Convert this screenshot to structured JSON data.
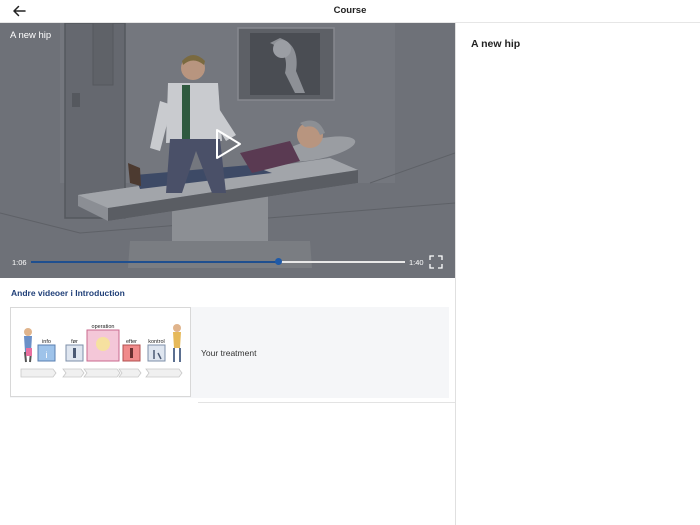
{
  "header": {
    "title": "Course",
    "back_icon": "arrow-left-icon"
  },
  "player": {
    "video_title": "A new hip",
    "current_time": "1:06",
    "total_time": "1:40",
    "progress_fraction": 0.66,
    "play_icon": "play-icon",
    "fullscreen_icon": "fullscreen-icon",
    "progress_color": "#1f4f8f"
  },
  "related": {
    "section_title": "Andre videoer i Introduction",
    "items": [
      {
        "label": "Your treatment",
        "thumbnail": {
          "steps": [
            "info",
            "før",
            "operation",
            "efter",
            "kontrol"
          ]
        }
      }
    ]
  },
  "side_panel": {
    "title": "A new hip"
  },
  "colors": {
    "accent": "#1f3f78",
    "overlay": "#6b6e74"
  }
}
